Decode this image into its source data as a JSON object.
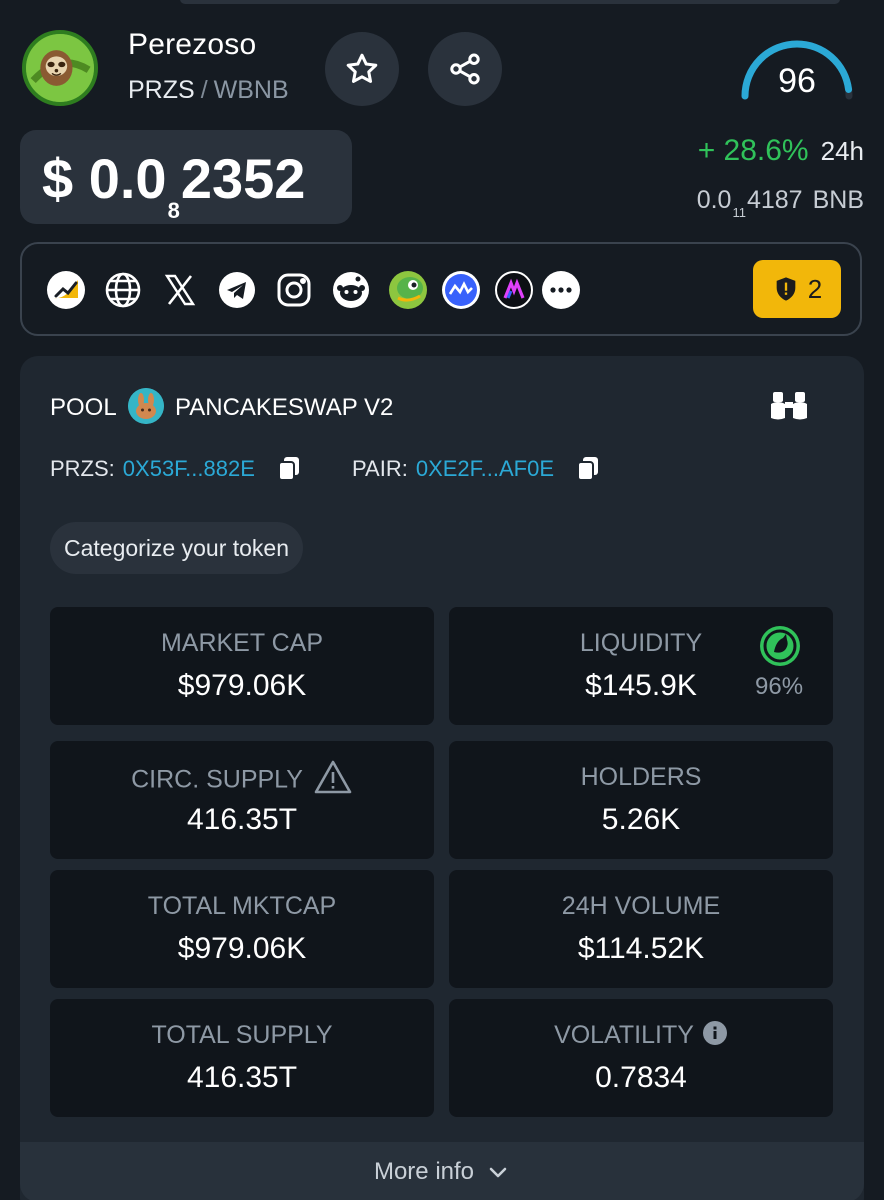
{
  "token": {
    "name": "Perezoso",
    "symbol": "PRZS",
    "separator": "/",
    "quote": "WBNB",
    "logo_icon": "sloth-logo-icon"
  },
  "actions": {
    "favorite_icon": "star-icon",
    "share_icon": "share-icon"
  },
  "score": {
    "value": "96",
    "fraction": 0.96,
    "color": "#2ba9d6"
  },
  "price": {
    "prefix": "$ 0.0",
    "zeros": "8",
    "digits": "2352"
  },
  "change": {
    "value": "+ 28.6%",
    "period": "24h",
    "color": "#30c25a"
  },
  "bnb_price": {
    "prefix": "0.0",
    "zeros": "11",
    "digits": "4187",
    "unit": "BNB"
  },
  "links": {
    "icons": [
      "chart-icon",
      "globe-icon",
      "x-icon",
      "telegram-icon",
      "instagram-icon",
      "reddit-icon",
      "coingecko-icon",
      "coinmarketcap-icon",
      "dextools-icon",
      "more-icon"
    ],
    "audit_count": "2",
    "audit_color": "#f2b70a"
  },
  "pool": {
    "label": "POOL",
    "dex": "PANCAKESWAP V2",
    "token_address_label": "PRZS:",
    "token_address": "0X53F...882E",
    "pair_address_label": "PAIR:",
    "pair_address": "0XE2F...AF0E",
    "categorize_label": "Categorize your token"
  },
  "stats": {
    "market_cap": {
      "label": "MARKET CAP",
      "value": "$979.06K"
    },
    "liquidity": {
      "label": "LIQUIDITY",
      "value": "$145.9K",
      "percent": "96%"
    },
    "circ_supply": {
      "label": "CIRC. SUPPLY",
      "value": "416.35T"
    },
    "holders": {
      "label": "HOLDERS",
      "value": "5.26K"
    },
    "total_mktcap": {
      "label": "TOTAL MKTCAP",
      "value": "$979.06K"
    },
    "volume_24h": {
      "label": "24H VOLUME",
      "value": "$114.52K"
    },
    "total_supply": {
      "label": "TOTAL SUPPLY",
      "value": "416.35T"
    },
    "volatility": {
      "label": "VOLATILITY",
      "value": "0.7834"
    }
  },
  "more_info_label": "More info"
}
